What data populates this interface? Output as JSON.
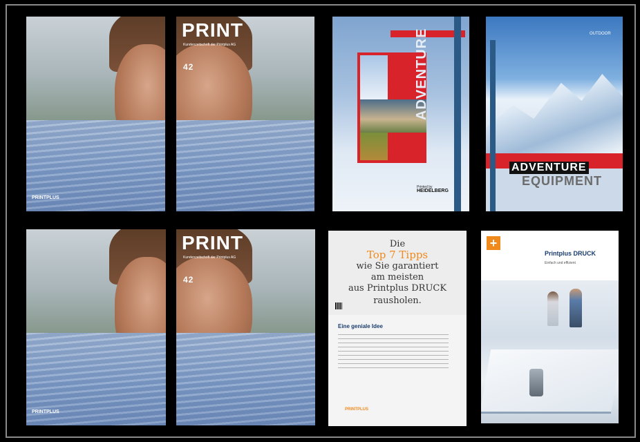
{
  "covers": {
    "print_title": "PRINT",
    "print_subtitle": "Kundenzeitschrift der Printplus AG",
    "print_issue": "42",
    "printplus_logo": "PRINTPLUS",
    "adventure_title": "ADVENTURE",
    "heidelberg_label": "HEIDELBERG",
    "heidelberg_small": "Printed by",
    "outdoor_label": "OUTDOOR",
    "adventure_equipment_1": "ADVENTURE",
    "adventure_equipment_2": "EQUIPMENT",
    "tips_die": "Die",
    "tips_top": "Top 7 Tipps",
    "tips_line1": "wie Sie garantiert",
    "tips_line2": "am meisten",
    "tips_line3": "aus Printplus DRUCK",
    "tips_line4": "rausholen.",
    "tips_heading": "Eine geniale Idee",
    "druck_title": "Printplus DRUCK",
    "druck_sub": "Einfach und effizient"
  },
  "colors": {
    "accent_orange": "#f08a1c",
    "red": "#d8232a",
    "spine_blue": "#2b5a86"
  }
}
